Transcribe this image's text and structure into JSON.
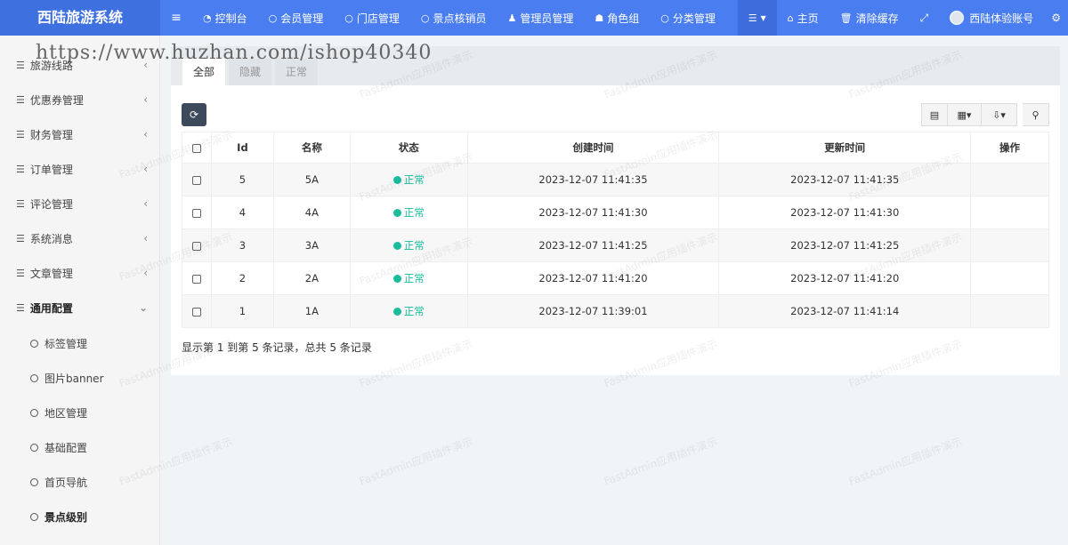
{
  "app": {
    "title": "西陆旅游系统"
  },
  "topnav": {
    "items": [
      {
        "icon": "dashboard-icon",
        "glyph": "◔",
        "label": "控制台"
      },
      {
        "icon": "circle-icon",
        "glyph": "○",
        "label": "会员管理"
      },
      {
        "icon": "circle-icon",
        "glyph": "○",
        "label": "门店管理"
      },
      {
        "icon": "circle-icon",
        "glyph": "○",
        "label": "景点核销员"
      },
      {
        "icon": "user-icon",
        "glyph": "♟",
        "label": "管理员管理"
      },
      {
        "icon": "users-icon",
        "glyph": "☗",
        "label": "角色组"
      },
      {
        "icon": "circle-icon",
        "glyph": "○",
        "label": "分类管理"
      }
    ],
    "right": {
      "home_label": "主页",
      "clear_cache_label": "清除缓存",
      "account_label": "西陆体验账号"
    }
  },
  "watermark_url": "https://www.huzhan.com/ishop40340",
  "watermark_text": "FastAdmin应用插件演示",
  "sidebar": {
    "items": [
      {
        "label": "旅游线路"
      },
      {
        "label": "优惠券管理"
      },
      {
        "label": "财务管理"
      },
      {
        "label": "订单管理"
      },
      {
        "label": "评论管理"
      },
      {
        "label": "系统消息"
      },
      {
        "label": "文章管理"
      },
      {
        "label": "通用配置"
      }
    ],
    "subitems": [
      {
        "label": "标签管理"
      },
      {
        "label": "图片banner"
      },
      {
        "label": "地区管理"
      },
      {
        "label": "基础配置"
      },
      {
        "label": "首页导航"
      },
      {
        "label": "景点级别"
      }
    ]
  },
  "tabs": [
    {
      "label": "全部"
    },
    {
      "label": "隐藏"
    },
    {
      "label": "正常"
    }
  ],
  "table": {
    "columns": [
      "Id",
      "名称",
      "状态",
      "创建时间",
      "更新时间",
      "操作"
    ],
    "rows": [
      {
        "id": "5",
        "name": "5A",
        "status": "正常",
        "created": "2023-12-07 11:41:35",
        "updated": "2023-12-07 11:41:35"
      },
      {
        "id": "4",
        "name": "4A",
        "status": "正常",
        "created": "2023-12-07 11:41:30",
        "updated": "2023-12-07 11:41:30"
      },
      {
        "id": "3",
        "name": "3A",
        "status": "正常",
        "created": "2023-12-07 11:41:25",
        "updated": "2023-12-07 11:41:25"
      },
      {
        "id": "2",
        "name": "2A",
        "status": "正常",
        "created": "2023-12-07 11:41:20",
        "updated": "2023-12-07 11:41:20"
      },
      {
        "id": "1",
        "name": "1A",
        "status": "正常",
        "created": "2023-12-07 11:39:01",
        "updated": "2023-12-07 11:41:14"
      }
    ]
  },
  "pager_info": "显示第 1 到第 5 条记录，总共 5 条记录",
  "colors": {
    "navbar": "#4a7df0",
    "status_green": "#18bc9c",
    "refresh_btn": "#3d4a5c"
  }
}
